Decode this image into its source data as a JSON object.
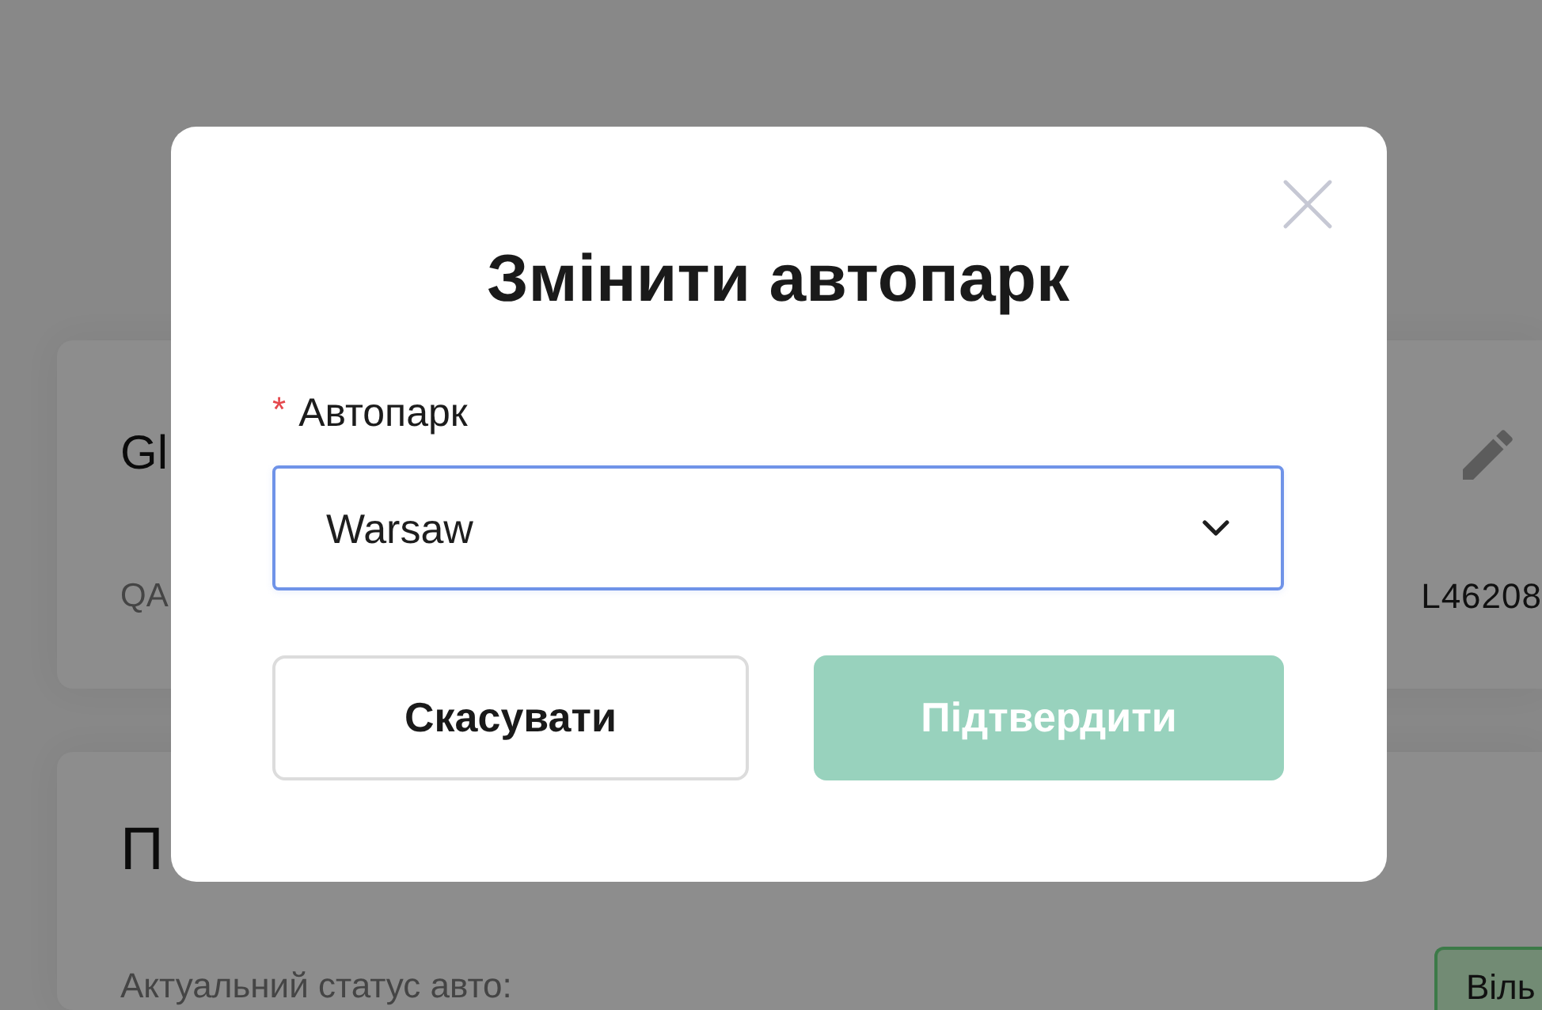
{
  "background_page": {
    "upper_card": {
      "title": "Gl",
      "row_label": "QA",
      "row_value": "L46208"
    },
    "lower_card": {
      "title": "П",
      "row_label": "Актуальний статус авто:",
      "status_button": "Віль"
    }
  },
  "dialog": {
    "title": "Змінити автопарк",
    "field": {
      "required_mark": "*",
      "label": "Автопарк",
      "value": "Warsaw",
      "focused": true
    },
    "buttons": [
      {
        "label": "Скасувати",
        "kind": "secondary",
        "disabled": false
      },
      {
        "label": "Підтвердити",
        "kind": "primary",
        "disabled": true
      }
    ]
  }
}
